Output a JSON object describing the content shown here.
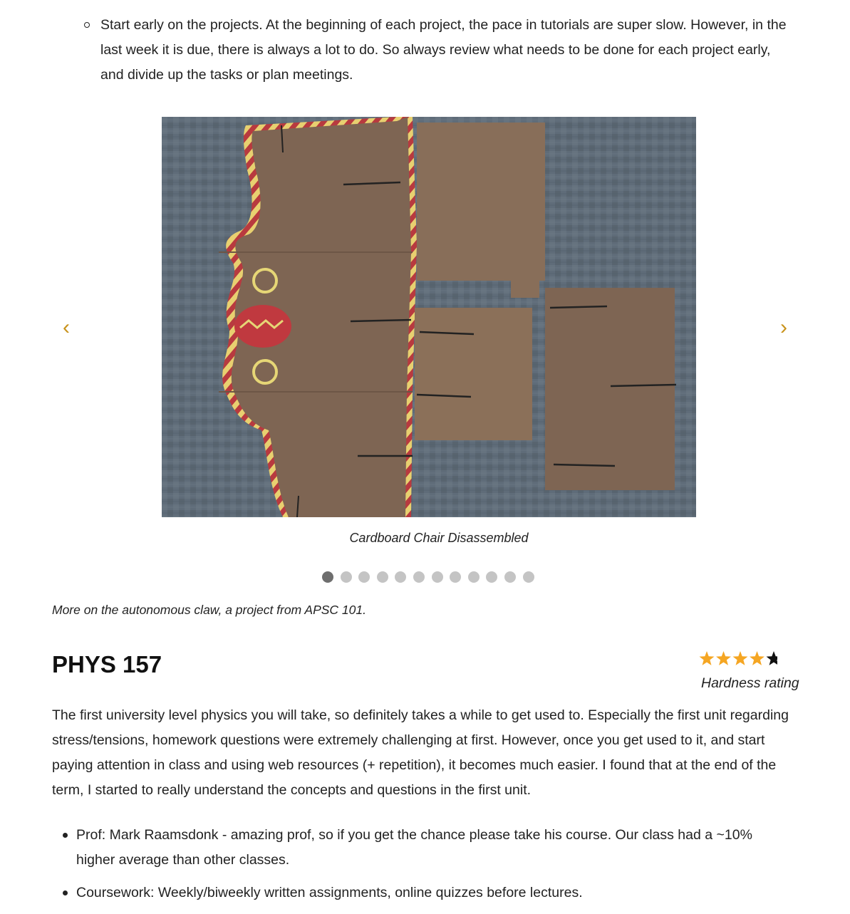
{
  "tip_list": [
    "Start early on the projects. At the beginning of each project, the pace in tutorials are super slow. However, in the last week it is due, there is always a lot to do. So always review what needs to be done for each project early, and divide up the tasks or plan meetings."
  ],
  "carousel": {
    "prev_glyph": "‹",
    "next_glyph": "›",
    "caption": "Cardboard Chair Disassembled",
    "slide_count": 12,
    "active_slide_index": 0,
    "arrow_color": "#c8921a"
  },
  "section_note": "More on the autonomous claw, a project from APSC 101.",
  "course": {
    "title": "PHYS 157",
    "hardness_rating": {
      "filled_stars": 4,
      "total_stars": 5,
      "label": "Hardness rating",
      "filled_color": "#f5a623",
      "empty_color": "#111111"
    },
    "intro": "The first university level physics you will take, so definitely takes a while to get used to. Especially the first unit regarding stress/tensions, homework questions were extremely challenging at first. However, once you get used to it, and start paying attention in class and using web resources (+ repetition), it becomes much easier. I found that at the end of the term, I started to really understand the concepts and questions in the first unit.",
    "bullets": [
      "Prof: Mark Raamsdonk - amazing prof, so if you get the chance please take his course. Our class had a ~10% higher average than other classes.",
      "Coursework: Weekly/biweekly written assignments, online quizzes before lectures."
    ]
  }
}
